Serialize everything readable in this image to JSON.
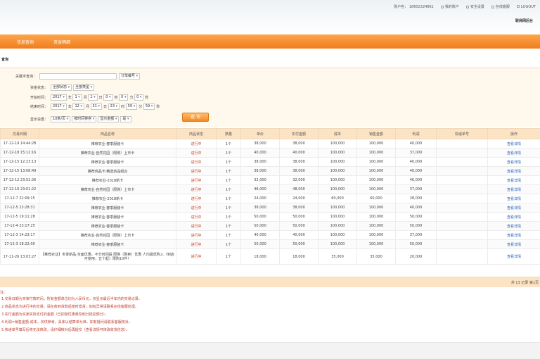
{
  "header": {
    "account_label": "账户名： 18602324861",
    "links": [
      "我的账户",
      "安全设置",
      "在线客服",
      "LOGOUT"
    ],
    "brand": "联商网后台"
  },
  "nav": {
    "items": [
      "信息查询",
      "资金明细"
    ]
  },
  "page_title": "查询",
  "filter": {
    "row1": {
      "label": "关键字查询：",
      "input_value": "",
      "select": "订单编号"
    },
    "row2": {
      "label": "资金状态：",
      "select_a": "全部状态",
      "select_b": "全部类型"
    },
    "row3": {
      "label": "开始时间：",
      "year": "2017",
      "month": "1",
      "day": "1",
      "h": "0",
      "m": "0",
      "s": "0",
      "unit_year": "年",
      "unit_month": "月",
      "unit_day": "日",
      "unit_h": "时",
      "unit_m": "分",
      "unit_s": "秒"
    },
    "row4": {
      "label": "结束时间：",
      "year": "2017",
      "month": "12",
      "day": "31",
      "h": "23",
      "m": "59",
      "s": "59"
    },
    "row5": {
      "label": "显示设置：",
      "select_a": "10条/页",
      "select_b": "按时间排序",
      "select_c": "显示金额",
      "select_d": "是"
    },
    "query_button": "查 询"
  },
  "table": {
    "headers": [
      "交易日期",
      "商品名称",
      "商品状态",
      "数量",
      "单价",
      "实付金额",
      "成本",
      "销售金额",
      "利润",
      "快递单号",
      "操作"
    ],
    "rows": [
      [
        "17-12-19 14:44:28",
        "推荐农业·春季服装卡",
        "进行中",
        "1个",
        "38,000",
        "38,000",
        "100,000",
        "100,000",
        "40,000",
        "",
        "查看详情"
      ],
      [
        "17-12-18 15:12:16",
        "推荐农业·自然花园（限购）上市卡",
        "进行中",
        "1个",
        "40,000",
        "40,000",
        "100,000",
        "100,000",
        "37,000",
        "",
        "查看详情"
      ],
      [
        "17-12-15 12:23:13",
        "推荐农业·春季服装卡",
        "进行中",
        "1个",
        "38,000",
        "38,000",
        "100,000",
        "100,000",
        "40,000",
        "",
        "查看详情"
      ],
      [
        "17-12-15 13:08:49",
        "推荐商品卡·精选商品组合",
        "进行中",
        "1个",
        "38,000",
        "38,000",
        "100,000",
        "100,000",
        "40,000",
        "",
        "查看详情"
      ],
      [
        "17-12-12 23:52:26",
        "推荐农业·2018新卡",
        "进行中",
        "1个",
        "32,000",
        "32,000",
        "100,000",
        "100,000",
        "46,000",
        "",
        "查看详情"
      ],
      [
        "17-12-10 23:01:22",
        "推荐农业·自然花园（限购）上市卡",
        "进行中",
        "1个",
        "48,000",
        "48,000",
        "100,000",
        "100,000",
        "37,000",
        "",
        "查看详情"
      ],
      [
        "17-12-7 22:09:15",
        "推荐农业·2018新卡",
        "进行中",
        "1个",
        "24,000",
        "24,000",
        "60,000",
        "60,000",
        "28,000",
        "",
        "查看详情"
      ],
      [
        "17-12-5 23:28:31",
        "推荐农业·春季服装卡",
        "进行中",
        "1个",
        "38,000",
        "38,000",
        "100,000",
        "100,000",
        "40,000",
        "",
        "查看详情"
      ],
      [
        "17-12-5 19:11:28",
        "推荐农业·春季服装卡",
        "进行中",
        "1个",
        "50,000",
        "50,000",
        "100,000",
        "100,000",
        "50,000",
        "",
        "查看详情"
      ],
      [
        "17-12-4 23:17:25",
        "推荐农业·春季服装卡",
        "进行中",
        "1个",
        "50,000",
        "50,000",
        "100,000",
        "100,000",
        "50,000",
        "",
        "查看详情"
      ],
      [
        "17-12-3 14:23:17",
        "推荐农业·自然花园（限购）上市卡",
        "进行中",
        "1个",
        "40,000",
        "40,000",
        "100,000",
        "100,000",
        "37,000",
        "",
        "查看详情"
      ],
      [
        "17-12-3 18:22:00",
        "推荐农业·春季服装卡",
        "进行中",
        "1个",
        "50,000",
        "50,000",
        "100,000",
        "100,000",
        "50,000",
        "",
        "查看详情"
      ],
      [
        "17-11-26 13:03:27",
        "【推荐农业】冬季新品·全面优惠，不分时间段 限购（刚卖）优惠 人均最低购入（到店可使用，五个起）限购10件！",
        "进行中",
        "1个",
        "18,000",
        "18,000",
        "35,000",
        "35,000",
        "20,000",
        "",
        "查看详情"
      ]
    ]
  },
  "pager": "共 13 记录  第1页",
  "notes": {
    "title": "注：",
    "lines": [
      "1.交易日期为买家付款时间，所有金额单位均为人民币元，仅显示最近半年内的交易记录。",
      "2.商品状态为进行中的交易，请在收到货款后按时发货，如有异常请联系在线客服处理。",
      "3.实付金额为买家实际支付的金额（已扣除优惠券及积分抵扣部分）。",
      "4.利润=销售金额-成本，仅供参考，具体以结算单为准，如有疑问请联系客服核对。",
      "5.快递单号填写后将无法修改，请仔细核对后再提交（查看详情可修改收货信息）。"
    ]
  }
}
